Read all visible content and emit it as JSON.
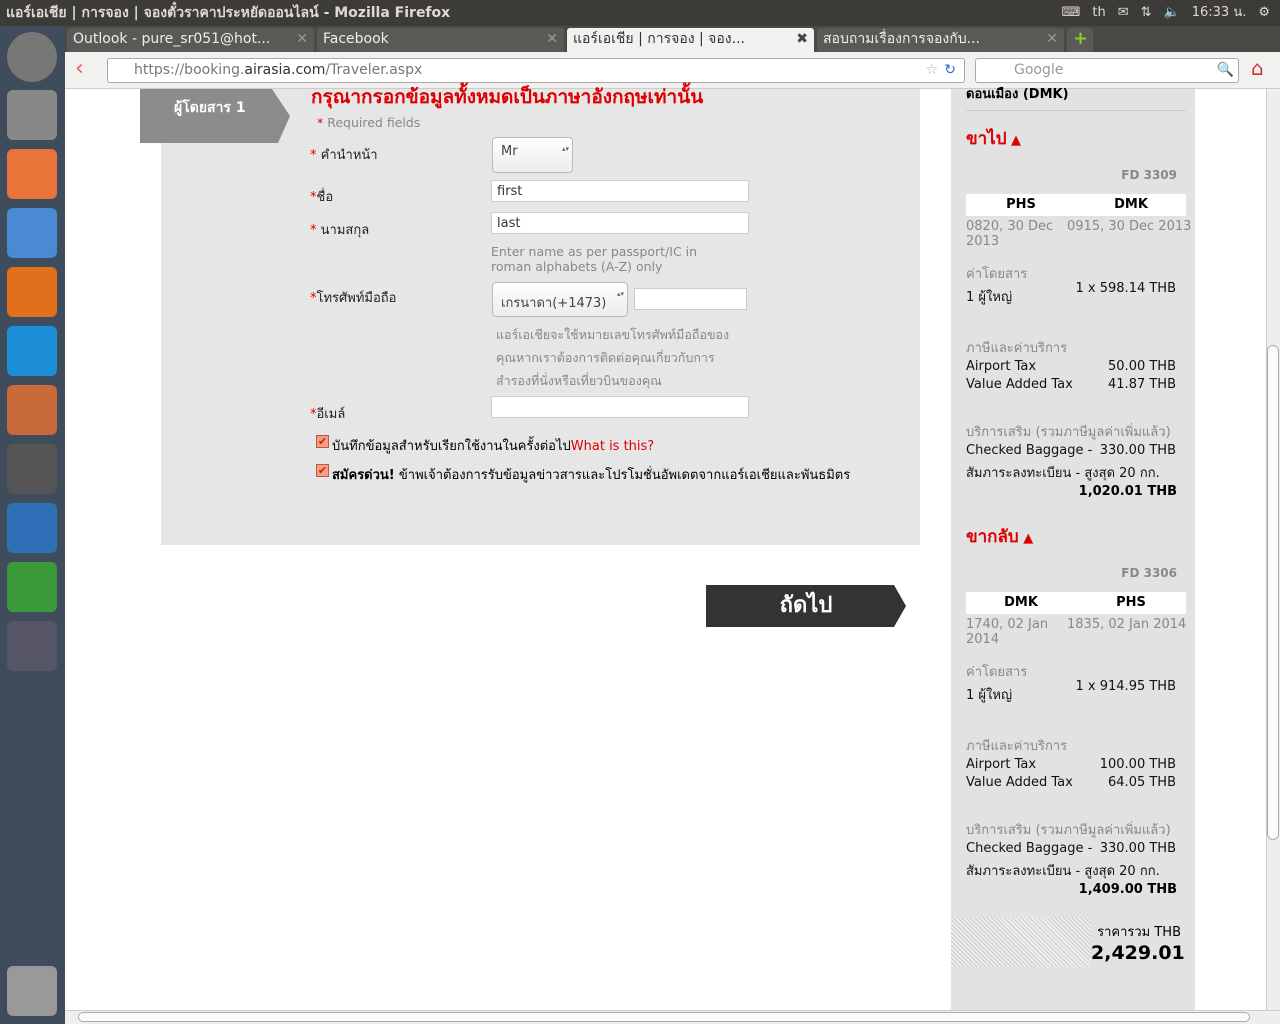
{
  "window": {
    "title": "แอร์เอเชีย | การจอง | จองตั๋วราคาประหยัดออนไลน์ - Mozilla Firefox",
    "tray_kbd": "th",
    "clock": "16:33 น."
  },
  "tabs": [
    {
      "label": "Outlook - pure_sr051@hot..."
    },
    {
      "label": "Facebook"
    },
    {
      "label": "แอร์เอเชีย | การจอง | จอง..."
    },
    {
      "label": "สอบถามเรื่องการจองกับ..."
    }
  ],
  "nav": {
    "url_pre": "https://booking.",
    "url_domain": "airasia.com",
    "url_post": "/Traveler.aspx",
    "search_placeholder": "Google"
  },
  "form": {
    "ribbon": "ผู้โดยสาร 1",
    "heading": "กรุณากรอกข้อมูลทั้งหมดเป็นภาษาอังกฤษเท่านั้น",
    "required": "Required fields",
    "title_label": "คำนำหน้า",
    "title_value": "Mr",
    "first_label": "ชื่อ",
    "first_value": "first",
    "last_label": "นามสกุล",
    "last_value": "last",
    "name_hint": "Enter name as per passport/IC in roman alphabets (A-Z) only",
    "phone_label": "โทรศัพท์มือถือ",
    "phone_country": "เกรนาดา(+1473)",
    "phone_value": "",
    "phone_hint1": "แอร์เอเชียจะใช้หมายเลขโทรศัพท์มือถือของ",
    "phone_hint2": "คุณหากเราต้องการติดต่อคุณเกี่ยวกับการ",
    "phone_hint3": "สำรองที่นั่งหรือเที่ยวบินของคุณ",
    "email_label": "อีเมล์",
    "email_value": "",
    "save_label": "บันทึกข้อมูลสำหรับเรียกใช้งานในครั้งต่อไป",
    "what_link": "What is this?",
    "sub_bold": "สมัครด่วน!",
    "sub_text": " ข้าพเจ้าต้องการรับข้อมูลข่าวสารและโปรโมชั่นอัพเดตจากแอร์เอเชียและพันธมิตร",
    "next": "ถัดไป"
  },
  "summary": {
    "top_cut": "ดอนเมือง (DMK)",
    "depart": {
      "heading": "ขาไป",
      "flight": "FD 3309",
      "from": "PHS",
      "to": "DMK",
      "dep_time": "0820, 30 Dec 2013",
      "arr_time": "0915, 30 Dec 2013",
      "fare_label": "ค่าโดยสาร",
      "pax": "1 ผู้ใหญ่",
      "fare": "1 x 598.14 THB",
      "tax_label": "ภาษีและค่าบริการ",
      "airport_tax": "Airport Tax",
      "airport_tax_v": "50.00 THB",
      "vat": "Value Added Tax",
      "vat_v": "41.87 THB",
      "addon_label": "บริการเสริม  (รวมภาษีมูลค่าเพิ่มแล้ว)",
      "bag": "Checked Baggage -",
      "bag_v": "330.00 THB",
      "bag2": "สัมภาระลงทะเบียน - สูงสุด 20 กก.",
      "total": "1,020.01 THB"
    },
    "return": {
      "heading": "ขากลับ",
      "flight": "FD 3306",
      "from": "DMK",
      "to": "PHS",
      "dep_time": "1740, 02 Jan 2014",
      "arr_time": "1835, 02 Jan 2014",
      "fare_label": "ค่าโดยสาร",
      "pax": "1 ผู้ใหญ่",
      "fare": "1 x 914.95 THB",
      "tax_label": "ภาษีและค่าบริการ",
      "airport_tax": "Airport Tax",
      "airport_tax_v": "100.00 THB",
      "vat": "Value Added Tax",
      "vat_v": "64.05 THB",
      "addon_label": "บริการเสริม  (รวมภาษีมูลค่าเพิ่มแล้ว)",
      "bag": "Checked Baggage -",
      "bag_v": "330.00 THB",
      "bag2": "สัมภาระลงทะเบียน - สูงสุด 20 กก.",
      "total": "1,409.00 THB"
    },
    "grand_label": "ราคารวม  THB",
    "grand_total": "2,429.01"
  }
}
